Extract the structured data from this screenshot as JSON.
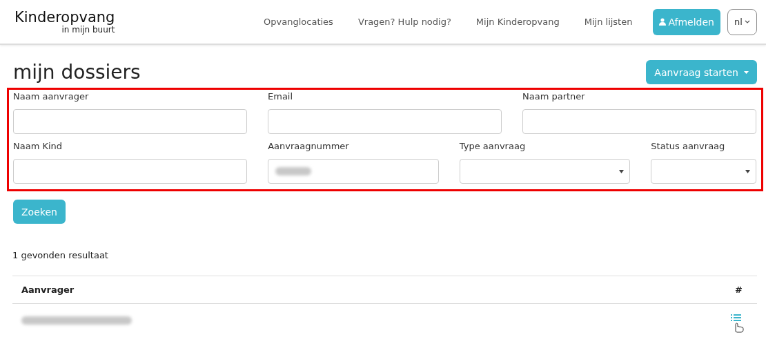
{
  "logo": {
    "title": "Kinderopvang",
    "subtitle": "in mijn buurt"
  },
  "nav": [
    {
      "label": "Opvanglocaties"
    },
    {
      "label": "Vragen? Hulp nodig?"
    },
    {
      "label": "Mijn Kinderopvang"
    },
    {
      "label": "Mijn lijsten"
    }
  ],
  "logout_button": "Afmelden",
  "language": "nl",
  "page_title": "mijn dossiers",
  "start_button": "Aanvraag starten",
  "filter_rows": [
    [
      {
        "label": "Naam aanvrager",
        "kind": "text"
      },
      {
        "label": "Email",
        "kind": "text"
      },
      {
        "label": "Naam partner",
        "kind": "text"
      }
    ],
    [
      {
        "label": "Naam Kind",
        "kind": "text"
      },
      {
        "label": "Aanvraagnummer",
        "kind": "text",
        "redacted": true
      },
      {
        "label": "Type aanvraag",
        "kind": "select"
      },
      {
        "label": "Status aanvraag",
        "kind": "select"
      }
    ]
  ],
  "search_button": "Zoeken",
  "result_count": "1 gevonden resultaat",
  "table": {
    "columns": [
      "Aanvrager",
      "#"
    ],
    "rows": [
      {
        "redacted": true
      }
    ]
  }
}
